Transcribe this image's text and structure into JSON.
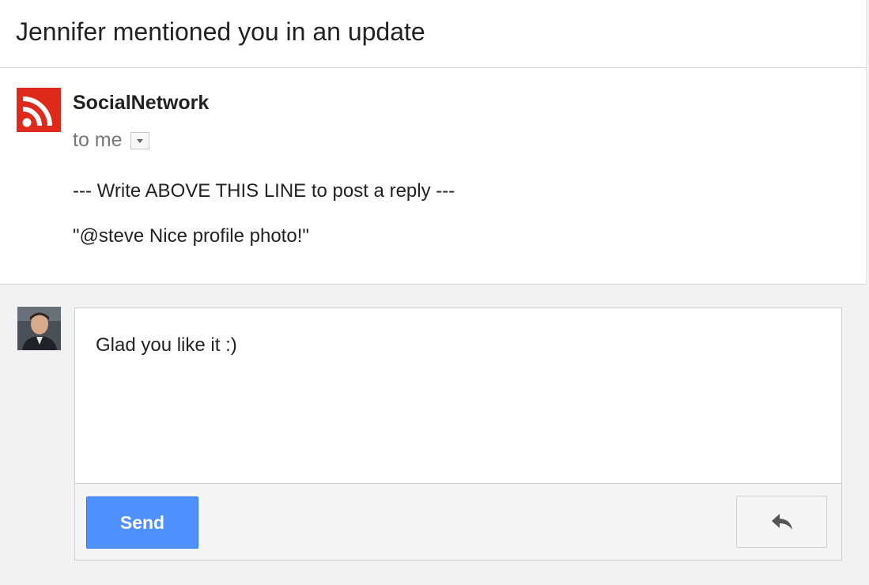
{
  "subject": "Jennifer mentioned you in an update",
  "message": {
    "sender_icon": "rss-feed-icon",
    "sender_name": "SocialNetwork",
    "recipient": "to me",
    "details_icon": "chevron-down-icon",
    "body_lines": [
      "--- Write ABOVE THIS LINE to post a reply ---",
      "\"@steve Nice profile photo!\""
    ]
  },
  "reply": {
    "user_avatar": "user-photo",
    "draft_text": "Glad you like it :)",
    "send_label": "Send",
    "reply_type_icon": "reply-arrow-icon"
  },
  "colors": {
    "sender_avatar": "#dd2a1b",
    "send_button": "#4d90fe"
  }
}
